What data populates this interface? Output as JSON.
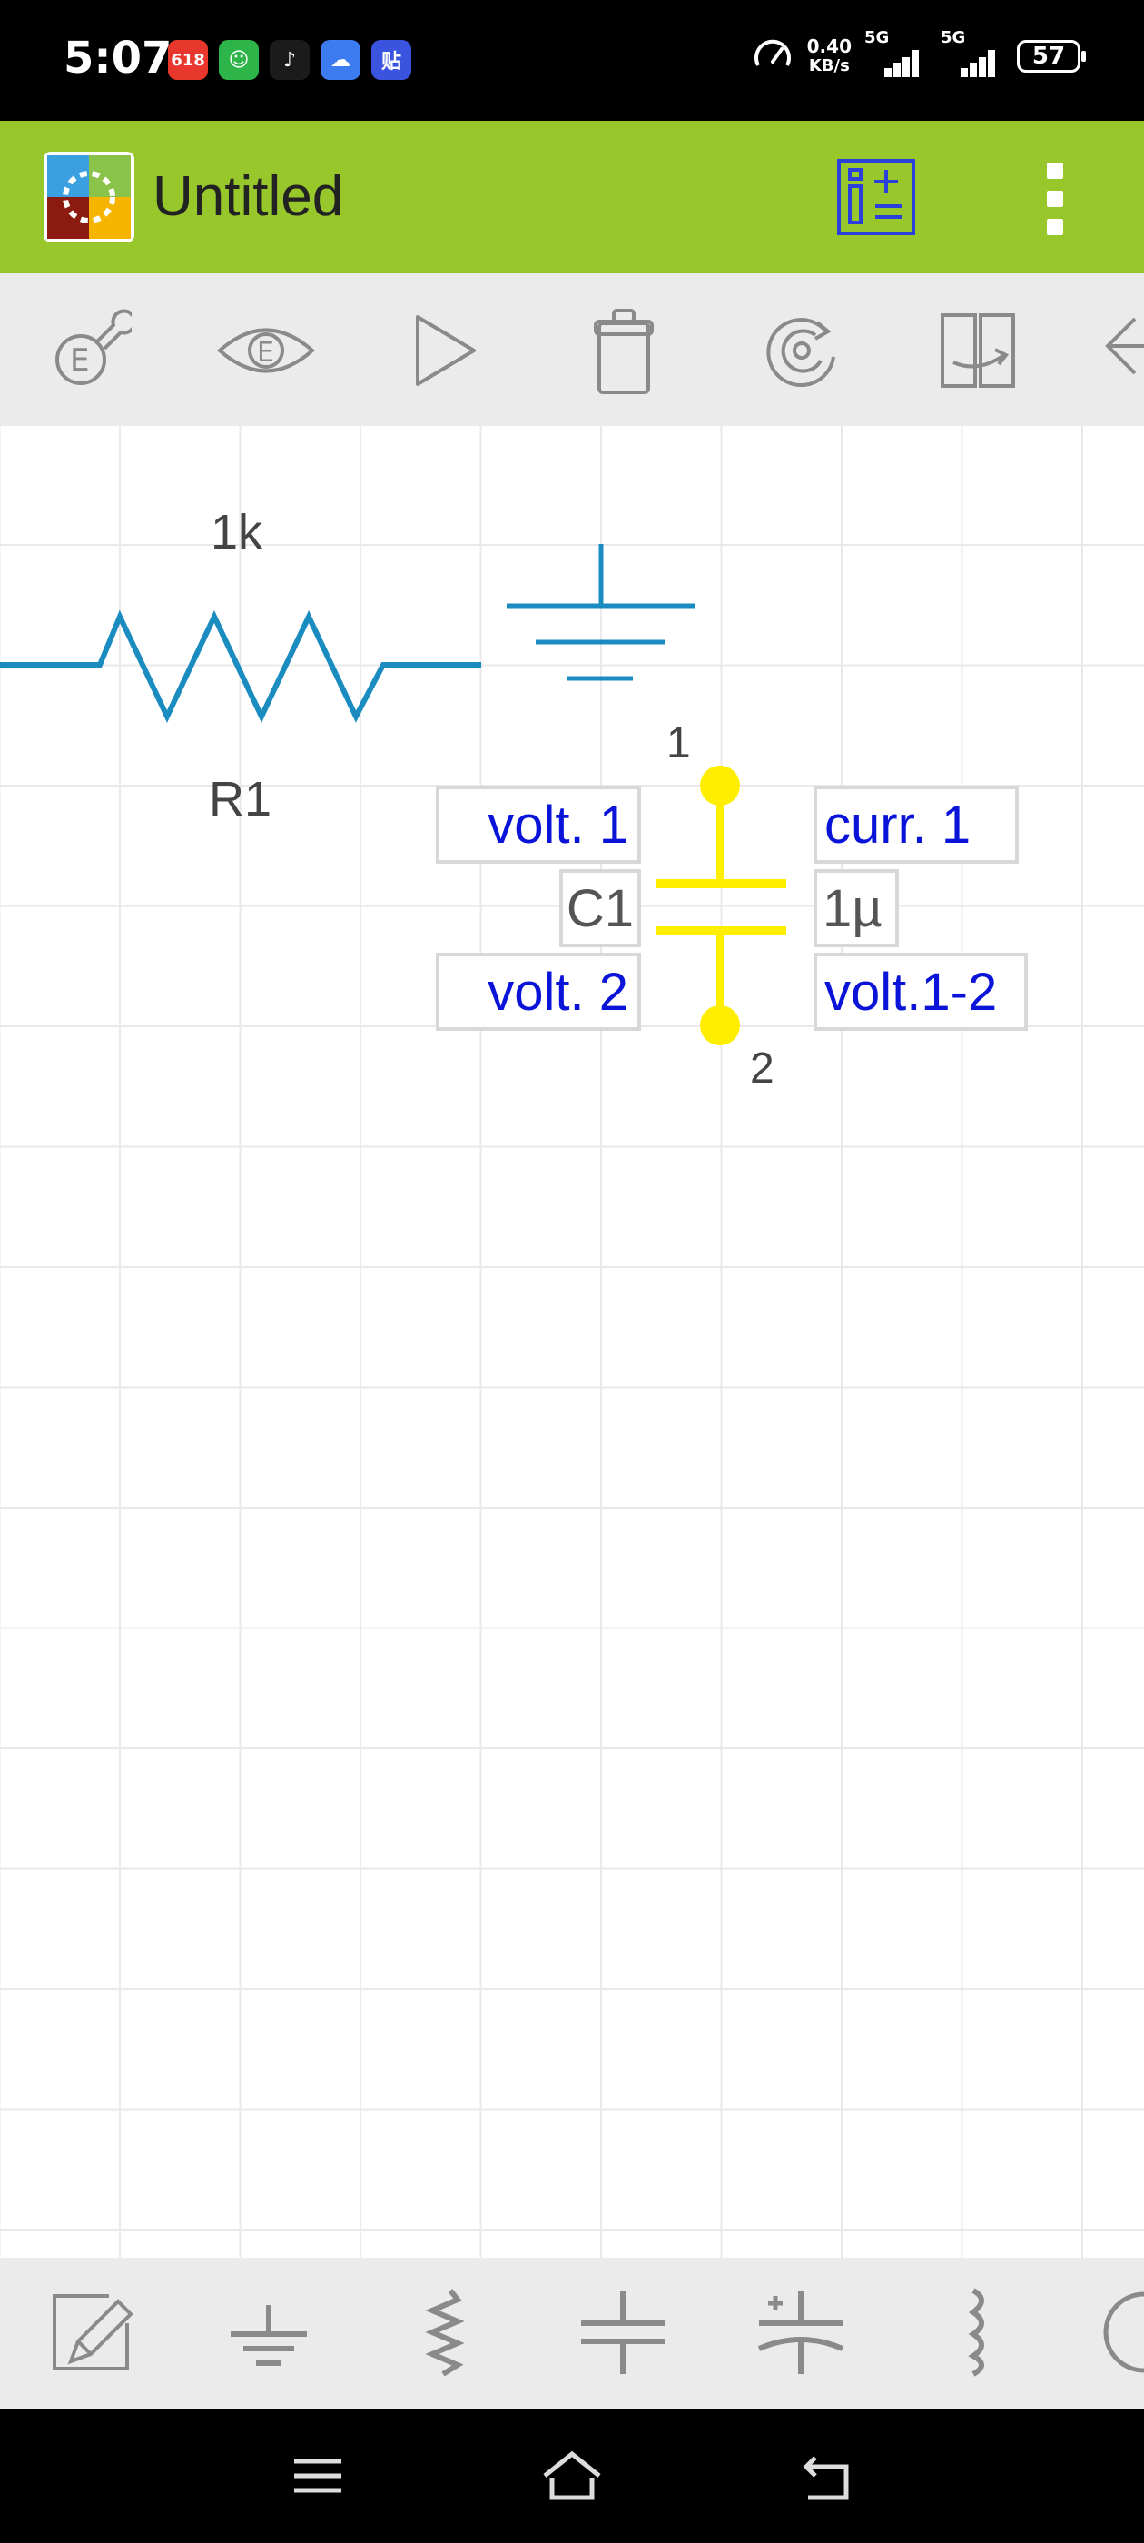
{
  "status_bar": {
    "time": "5:07",
    "notif_icons": [
      {
        "name": "shopping-618-icon",
        "glyph": "618",
        "color": "#e8382d"
      },
      {
        "name": "app-green-icon",
        "glyph": "☺",
        "color": "#2db54a"
      },
      {
        "name": "tiktok-icon",
        "glyph": "♪",
        "color": "#1b1b1b"
      },
      {
        "name": "cloud-app-icon",
        "glyph": "☁",
        "color": "#3d7bf0"
      },
      {
        "name": "tieba-icon",
        "glyph": "贴",
        "color": "#3a54e0"
      }
    ],
    "net_speed_value": "0.40",
    "net_speed_unit": "KB/s",
    "signal1_label": "5G",
    "signal2_label": "5G",
    "battery": "57"
  },
  "app_bar": {
    "title": "Untitled",
    "bg_color": "#97c72a"
  },
  "top_toolbar": {
    "tools": [
      "edit-settings-icon",
      "view-eye-icon",
      "play-icon",
      "delete-icon",
      "rotate-icon",
      "flip-icon",
      "more-tools-icon"
    ]
  },
  "circuit": {
    "resistor_value": "1k",
    "resistor_name": "R1",
    "capacitor_name": "C1",
    "capacitor_value": "1µ",
    "pin1_label": "1",
    "pin2_label": "2",
    "probe_volt1": "volt. 1",
    "probe_volt2": "volt. 2",
    "probe_curr1": "curr. 1",
    "probe_volt12": "volt.1-2",
    "wire_color": "#1a8cc0",
    "selected_color": "#ffee00",
    "probe_text_color": "#0a14d8"
  },
  "bottom_toolbar": {
    "tools": [
      "draw-wire-icon",
      "ground-icon",
      "resistor-icon",
      "capacitor-icon",
      "polarized-capacitor-icon",
      "inductor-icon",
      "more-components-icon"
    ]
  },
  "nav_bar": {
    "buttons": [
      "menu-icon",
      "home-icon",
      "back-icon"
    ]
  }
}
